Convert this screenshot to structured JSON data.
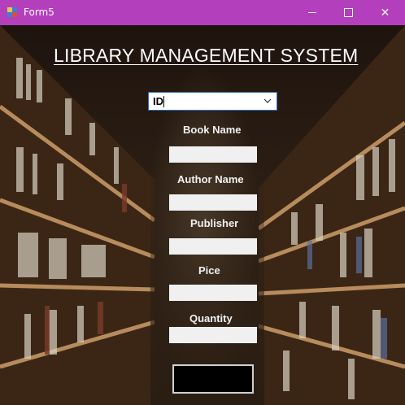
{
  "window": {
    "title": "Form5",
    "minimize_label": "",
    "maximize_label": "",
    "close_label": "✕"
  },
  "heading": "LIBRARY  MANAGEMENT SYSTEM",
  "search_combo": {
    "selected": "ID"
  },
  "fields": {
    "book_name": {
      "label": "Book Name",
      "value": ""
    },
    "author_name": {
      "label": "Author Name",
      "value": ""
    },
    "publisher": {
      "label": "Publisher",
      "value": ""
    },
    "price": {
      "label": "Pice",
      "value": ""
    },
    "quantity": {
      "label": "Quantity",
      "value": ""
    }
  },
  "submit_button": {
    "label": ""
  },
  "colors": {
    "titlebar": "#b43fbd",
    "combo_border": "#2f6fc4",
    "field_bg": "#f0f0f0",
    "button_bg": "#000000"
  },
  "icons": {
    "app": "form-app-icon",
    "combo_arrow": "chevron-down-icon"
  }
}
